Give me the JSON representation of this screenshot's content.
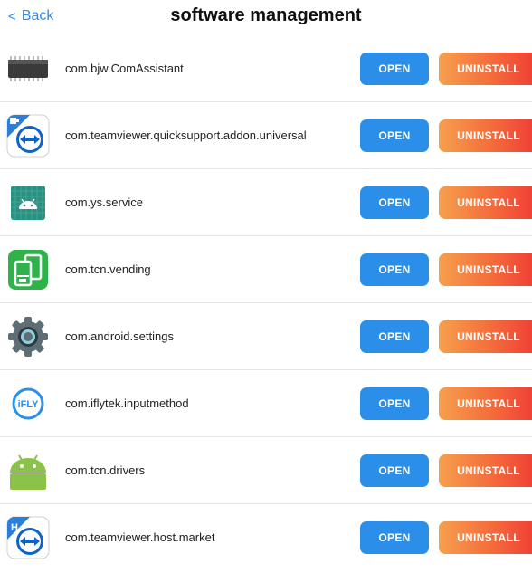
{
  "header": {
    "back_label": "Back",
    "back_icon": "chevron-left-icon",
    "title": "software management"
  },
  "colors": {
    "accent": "#2d8cf0",
    "open_button": "#2b8ee8",
    "uninstall_gradient": [
      "#f6a04d",
      "#ef3b35"
    ]
  },
  "apps": [
    {
      "package": "com.bjw.ComAssistant",
      "icon": "chip-icon",
      "open_label": "OPEN",
      "uninstall_label": "UNINSTALL"
    },
    {
      "package": "com.teamviewer.quicksupport.addon.universal",
      "icon": "teamviewer-addon-icon",
      "open_label": "OPEN",
      "uninstall_label": "UNINSTALL"
    },
    {
      "package": "com.ys.service",
      "icon": "android-tile-icon",
      "open_label": "OPEN",
      "uninstall_label": "UNINSTALL"
    },
    {
      "package": "com.tcn.vending",
      "icon": "vending-icon",
      "open_label": "OPEN",
      "uninstall_label": "UNINSTALL"
    },
    {
      "package": "com.android.settings",
      "icon": "gear-icon",
      "open_label": "OPEN",
      "uninstall_label": "UNINSTALL"
    },
    {
      "package": "com.iflytek.inputmethod",
      "icon": "ifly-icon",
      "open_label": "OPEN",
      "uninstall_label": "UNINSTALL"
    },
    {
      "package": "com.tcn.drivers",
      "icon": "android-robot-icon",
      "open_label": "OPEN",
      "uninstall_label": "UNINSTALL"
    },
    {
      "package": "com.teamviewer.host.market",
      "icon": "teamviewer-host-icon",
      "open_label": "OPEN",
      "uninstall_label": "UNINSTALL"
    }
  ]
}
